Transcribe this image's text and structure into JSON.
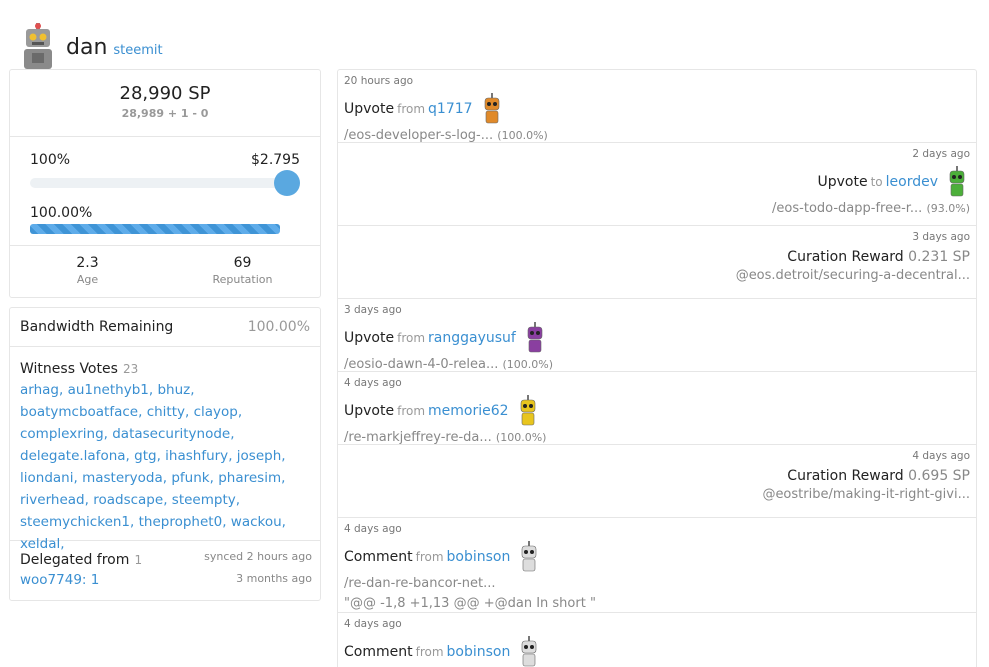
{
  "header": {
    "name": "dan",
    "app": "steemit"
  },
  "account": {
    "sp": "28,990 SP",
    "sp_breakdown": "28,989 + 1 - 0",
    "vote_weight": "100%",
    "vote_value": "$2.795",
    "voting_power": "100.00%",
    "voting_power_fraction": 1.0,
    "age_value": "2.3",
    "age_label": "Age",
    "rep_value": "69",
    "rep_label": "Reputation"
  },
  "bandwidth": {
    "label": "Bandwidth Remaining",
    "value": "100.00%"
  },
  "witness": {
    "title": "Witness Votes",
    "count": "23",
    "names": [
      "arhag",
      "au1nethyb1",
      "bhuz",
      "boatymcboatface",
      "chitty",
      "clayop",
      "complexring",
      "datasecuritynode",
      "delegate.lafona",
      "gtg",
      "ihashfury",
      "joseph",
      "liondani",
      "masteryoda",
      "pfunk",
      "pharesim",
      "riverhead",
      "roadscape",
      "steempty",
      "steemychicken1",
      "theprophet0",
      "wackou",
      "xeldal"
    ]
  },
  "delegated": {
    "title": "Delegated from",
    "count": "1",
    "synced": "synced 2 hours ago",
    "when": "3 months ago",
    "account": "woo7749",
    "amount": ": 1"
  },
  "feed": [
    {
      "time": "20 hours ago",
      "align": "left",
      "action": "Upvote",
      "prep": "from",
      "user": "q1717",
      "path": "/eos-developer-s-log-...",
      "weight": "(100.0%)",
      "robot": "#e08a2a"
    },
    {
      "time": "2 days ago",
      "align": "right",
      "action": "Upvote",
      "prep": "to",
      "user": "leordev",
      "path": "/eos-todo-dapp-free-r...",
      "weight": "(93.0%)",
      "robot": "#4caf3a"
    },
    {
      "time": "3 days ago",
      "align": "right",
      "action": "Curation Reward",
      "reward": "0.231 SP",
      "path": "@eos.detroit/securing-a-decentral..."
    },
    {
      "time": "3 days ago",
      "align": "left",
      "action": "Upvote",
      "prep": "from",
      "user": "ranggayusuf",
      "path": "/eosio-dawn-4-0-relea...",
      "weight": "(100.0%)",
      "robot": "#8a3fa0"
    },
    {
      "time": "4 days ago",
      "align": "left",
      "action": "Upvote",
      "prep": "from",
      "user": "memorie62",
      "path": "/re-markjeffrey-re-da...",
      "weight": "(100.0%)",
      "robot": "#e8c51e"
    },
    {
      "time": "4 days ago",
      "align": "right",
      "action": "Curation Reward",
      "reward": "0.695 SP",
      "path": "@eostribe/making-it-right-givi..."
    },
    {
      "time": "4 days ago",
      "align": "left",
      "action": "Comment",
      "prep": "from",
      "user": "bobinson",
      "path": "/re-dan-re-bancor-net...",
      "snippet": "\"@@ -1,8 +1,13 @@ +@dan In short \"",
      "robot": "#ddd"
    },
    {
      "time": "4 days ago",
      "align": "left",
      "action": "Comment",
      "prep": "from",
      "user": "bobinson",
      "robot": "#ddd"
    }
  ]
}
